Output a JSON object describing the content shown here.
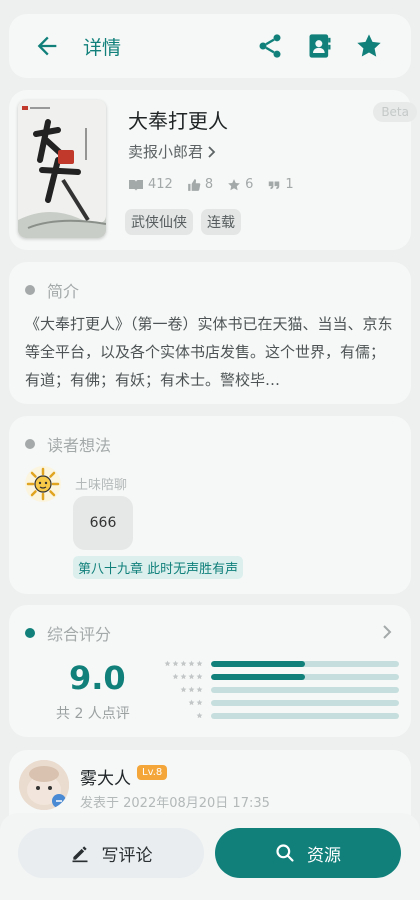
{
  "header": {
    "title": "详情"
  },
  "book": {
    "title": "大奉打更人",
    "author": "卖报小郎君",
    "beta": "Beta",
    "cover_title": "打更人",
    "cover_subtitle": "大奉",
    "cover_author": "卖报小郎君 著",
    "stats": {
      "reads": "412",
      "likes": "8",
      "stars": "6",
      "quotes": "1"
    },
    "tags": [
      "武侠仙侠",
      "连载"
    ]
  },
  "intro": {
    "heading": "简介",
    "text": "《大奉打更人》（第一卷）实体书已在天猫、当当、京东等全平台，以及各个实体书店发售。这个世界，有儒；有道；有佛；有妖；有术士。警校毕…"
  },
  "readers": {
    "heading": "读者想法",
    "name": "土味陪聊",
    "comment": "666",
    "chapter": "第八十九章 此时无声胜有声"
  },
  "rating": {
    "heading": "综合评分",
    "score": "9.0",
    "count_text": "共 2 人点评",
    "distribution": [
      {
        "stars": 5,
        "fraction": 0.5
      },
      {
        "stars": 4,
        "fraction": 0.5
      },
      {
        "stars": 3,
        "fraction": 0
      },
      {
        "stars": 2,
        "fraction": 0
      },
      {
        "stars": 1,
        "fraction": 0
      }
    ]
  },
  "review": {
    "name": "雾大人",
    "level": "Lv.8",
    "date": "发表于 2022年08月20日 17:35"
  },
  "bottom": {
    "comment_label": "写评论",
    "resource_label": "资源"
  },
  "colors": {
    "accent": "#11807b",
    "level_badge": "#f4a63a"
  }
}
